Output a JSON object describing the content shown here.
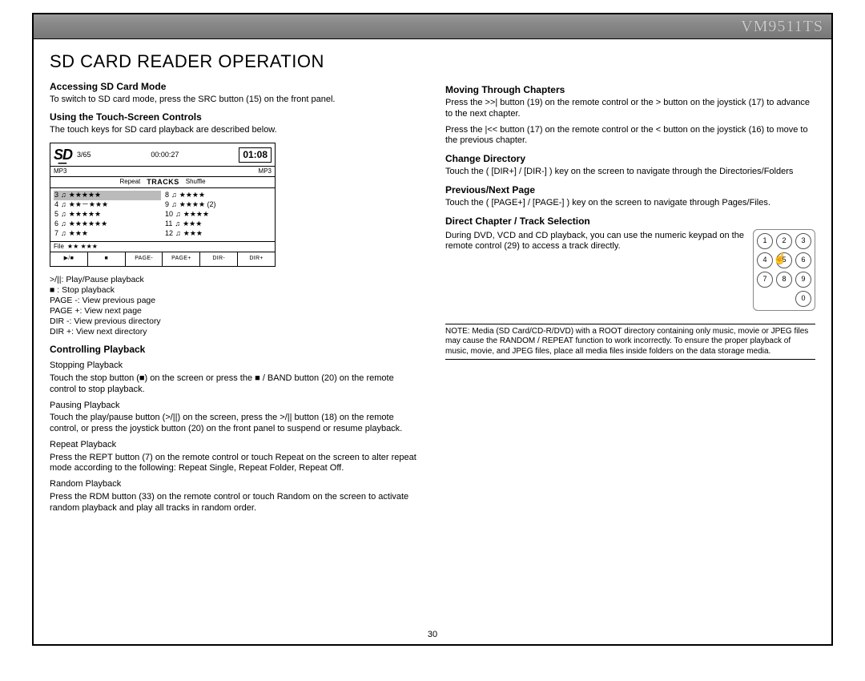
{
  "header": {
    "model": "VM9511TS"
  },
  "page_number": "30",
  "left": {
    "title": "SD CARD READER OPERATION",
    "s1": {
      "head": "Accessing SD Card Mode",
      "body": "To switch to SD card mode, press the SRC button (15) on the front panel."
    },
    "s2": {
      "head": "Using the Touch-Screen Controls",
      "body": "The touch keys for SD card playback are described below."
    },
    "device": {
      "counter": "3/65",
      "elapsed": "00:00:27",
      "clock": "01:08",
      "fmt_l": "MP3",
      "fmt_r": "MP3",
      "mode_repeat": "Repeat",
      "mode_tracks": "TRACKS",
      "mode_shuffle": "Shuffle",
      "listL": [
        {
          "n": "3",
          "t": "★★★★★"
        },
        {
          "n": "4",
          "t": "★★－★★★"
        },
        {
          "n": "5",
          "t": "★★★★★"
        },
        {
          "n": "6",
          "t": "★★★★★★"
        },
        {
          "n": "7",
          "t": "★★★"
        }
      ],
      "listR": [
        {
          "n": "8",
          "t": "★★★★"
        },
        {
          "n": "9",
          "t": "★★★★ (2)"
        },
        {
          "n": "10",
          "t": "★★★★"
        },
        {
          "n": "11",
          "t": "★★★"
        },
        {
          "n": "12",
          "t": "★★★"
        }
      ],
      "filebar": {
        "label": "File",
        "val": "★★  ★★★"
      },
      "btns": [
        "▶/■",
        "■",
        "PAGE-",
        "PAGE+",
        "DIR-",
        "DIR+"
      ]
    },
    "legend": {
      "l1": ">/||: Play/Pause playback",
      "l2": "■ : Stop playback",
      "l3": "PAGE -: View previous page",
      "l4": "PAGE +: View next page",
      "l5": "DIR -: View previous directory",
      "l6": "DIR +: View next directory"
    },
    "s3": {
      "head": "Controlling Playback",
      "a_h": "Stopping Playback",
      "a_b": "Touch the stop button (■) on the screen or press the  ■ / BAND button (20) on the remote control to stop playback.",
      "b_h": "Pausing Playback",
      "b_b": "Touch the play/pause button (>/||) on the screen, press the >/|| button (18) on the remote control, or press the joystick button (20) on the front panel to suspend or resume playback.",
      "c_h": "Repeat Playback",
      "c_b": "Press the REPT button (7) on the remote control or touch  Repeat  on the screen to alter repeat mode according to the following: Repeat Single, Repeat Folder, Repeat Off.",
      "d_h": "Random Playback",
      "d_b": "Press the RDM button (33) on the remote control or touch  Random  on the screen to activate random playback and play all tracks in random order."
    }
  },
  "right": {
    "s1": {
      "head": "Moving Through Chapters",
      "p1": "Press the >>| button (19) on the remote control or the > button on the joystick (17) to advance to the next chapter.",
      "p2": "Press the |<< button (17) on the remote control or the < button on the joystick (16) to move to the previous chapter."
    },
    "s2": {
      "head": "Change Directory",
      "p1": "Touch the ( [DIR+] / [DIR-] ) key on the screen to navigate through the Directories/Folders"
    },
    "s3": {
      "head": "Previous/Next Page",
      "p1": "Touch the ( [PAGE+] / [PAGE-] ) key on the screen to navigate through Pages/Files."
    },
    "s4": {
      "head": "Direct Chapter / Track Selection",
      "p1": "During DVD, VCD and CD playback, you can use the numeric keypad on the remote control (29) to access a track directly.",
      "keys": [
        "1",
        "2",
        "3",
        "4",
        "5",
        "6",
        "7",
        "8",
        "9",
        "0"
      ]
    },
    "note": "NOTE: Media (SD Card/CD-R/DVD) with a ROOT directory containing only music, movie or JPEG files may cause the RANDOM / REPEAT function to work incorrectly. To ensure the proper playback of music, movie, and JPEG files, place all media files inside folders on the data storage media."
  }
}
